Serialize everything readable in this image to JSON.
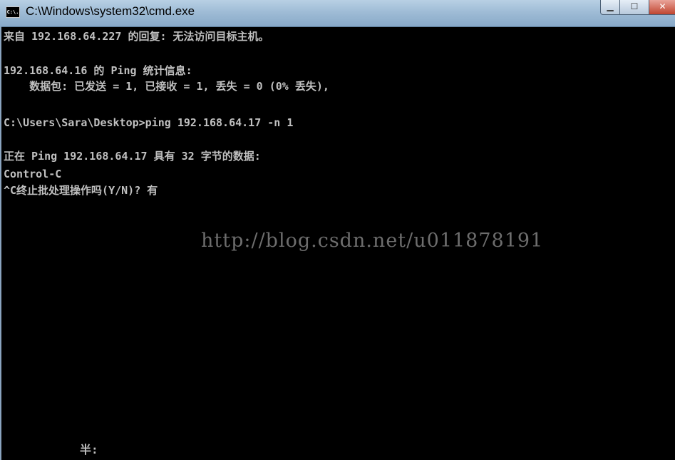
{
  "window": {
    "title": "C:\\Windows\\system32\\cmd.exe",
    "icon_name": "cmd-icon",
    "icon_text": "C:\\."
  },
  "controls": {
    "minimize": "▁",
    "maximize": "☐",
    "close": "✕"
  },
  "console": {
    "lines": [
      "来自 192.168.64.227 的回复: 无法访问目标主机。",
      "",
      "192.168.64.16 的 Ping 统计信息:",
      "    数据包: 已发送 = 1, 已接收 = 1, 丢失 = 0 (0% 丢失),",
      "",
      "C:\\Users\\Sara\\Desktop>ping 192.168.64.17 -n 1",
      "",
      "正在 Ping 192.168.64.17 具有 32 字节的数据:",
      "Control-C",
      "^C终止批处理操作吗(Y/N)? 有"
    ]
  },
  "watermark": "http://blog.csdn.net/u011878191",
  "ime_status": "半:"
}
